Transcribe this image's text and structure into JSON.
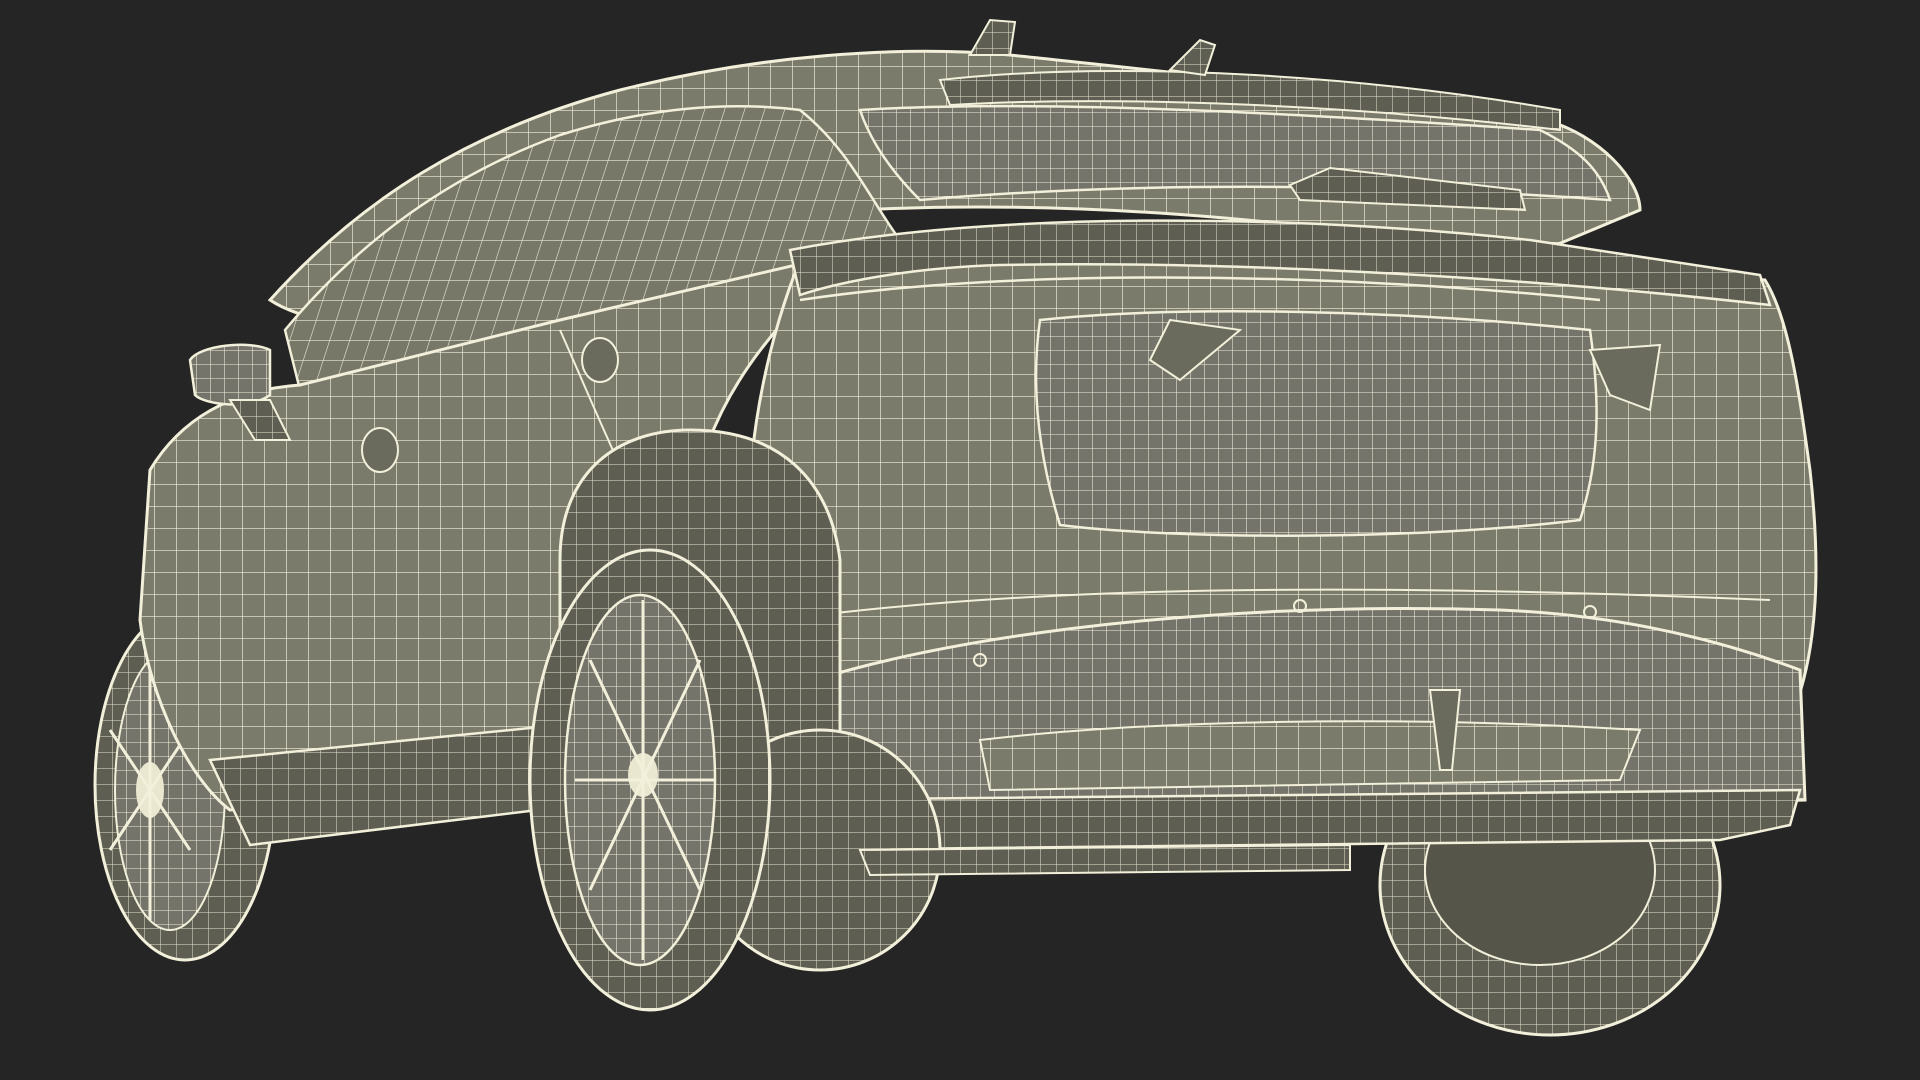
{
  "viewport": {
    "background": "#252525",
    "subject": "car-wireframe-render",
    "colors": {
      "surface": "#7b7b6c",
      "surface_dark": "#5f5f52",
      "wire": "#f2f0da",
      "tire": "#56564b"
    }
  }
}
